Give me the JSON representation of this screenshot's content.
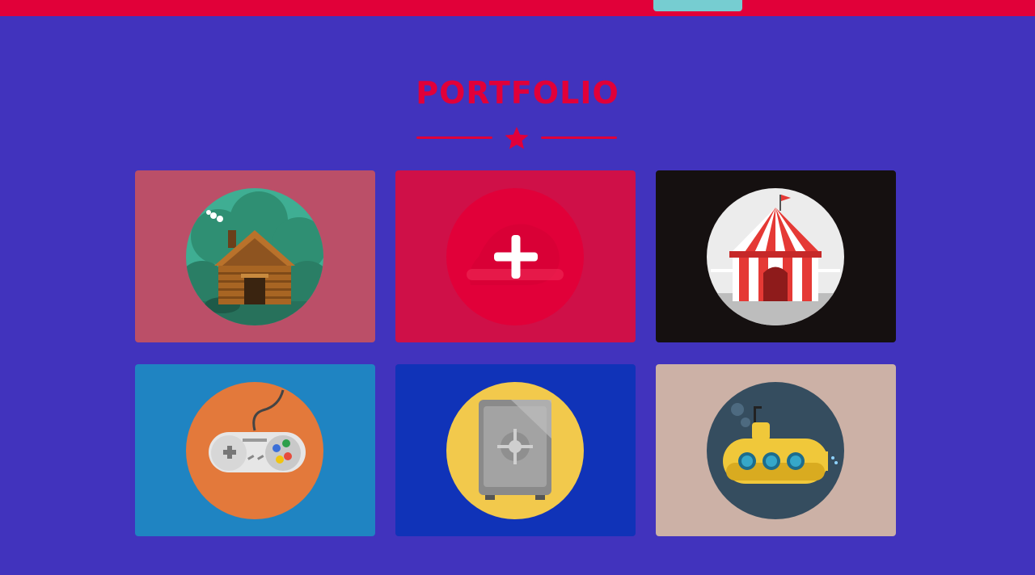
{
  "colors": {
    "background": "#4133bd",
    "accent": "#e10039",
    "topbar_tab": "#76cdd1"
  },
  "portfolio": {
    "title": "PORTFOLIO",
    "items": [
      {
        "icon": "log-cabin-icon",
        "bg": "#bb4f68",
        "hovered": false
      },
      {
        "icon": "plus-icon",
        "bg": "#cf1048",
        "hovered": true
      },
      {
        "icon": "circus-tent-icon",
        "bg": "#151010",
        "hovered": false
      },
      {
        "icon": "game-controller-icon",
        "bg": "#1f84c2",
        "hovered": false
      },
      {
        "icon": "safe-icon",
        "bg": "#1033b8",
        "hovered": false
      },
      {
        "icon": "submarine-icon",
        "bg": "#ccb1a6",
        "hovered": false
      }
    ]
  }
}
